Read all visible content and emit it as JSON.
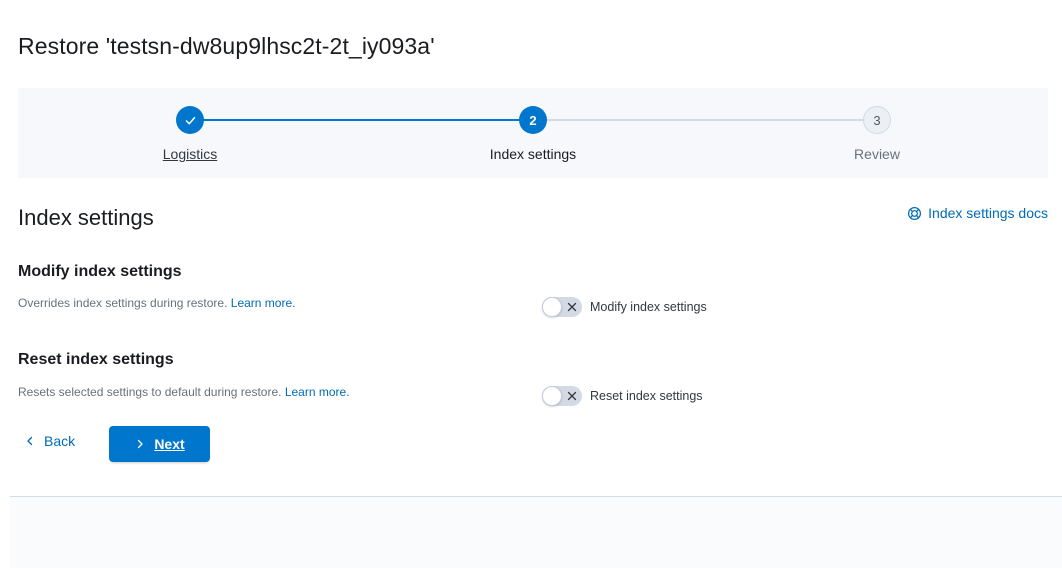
{
  "page": {
    "title": "Restore 'testsn-dw8up9lhsc2t-2t_iy093a'"
  },
  "steps": [
    {
      "number": "1",
      "title": "Logistics",
      "status": "complete"
    },
    {
      "number": "2",
      "title": "Index settings",
      "status": "current"
    },
    {
      "number": "3",
      "title": "Review",
      "status": "incomplete"
    }
  ],
  "section": {
    "title": "Index settings",
    "docs_link": "Index settings docs"
  },
  "settings": {
    "modify": {
      "title": "Modify index settings",
      "description": "Overrides index settings during restore.",
      "learn_more": "Learn more.",
      "switch_label": "Modify index settings",
      "enabled": false
    },
    "reset": {
      "title": "Reset index settings",
      "description": "Resets selected settings to default during restore.",
      "learn_more": "Learn more.",
      "switch_label": "Reset index settings",
      "enabled": false
    }
  },
  "nav": {
    "back_label": "Back",
    "next_label": "Next"
  },
  "colors": {
    "primary": "#0077cc",
    "link": "#006bb8",
    "step_incomplete": "#eceff4"
  }
}
